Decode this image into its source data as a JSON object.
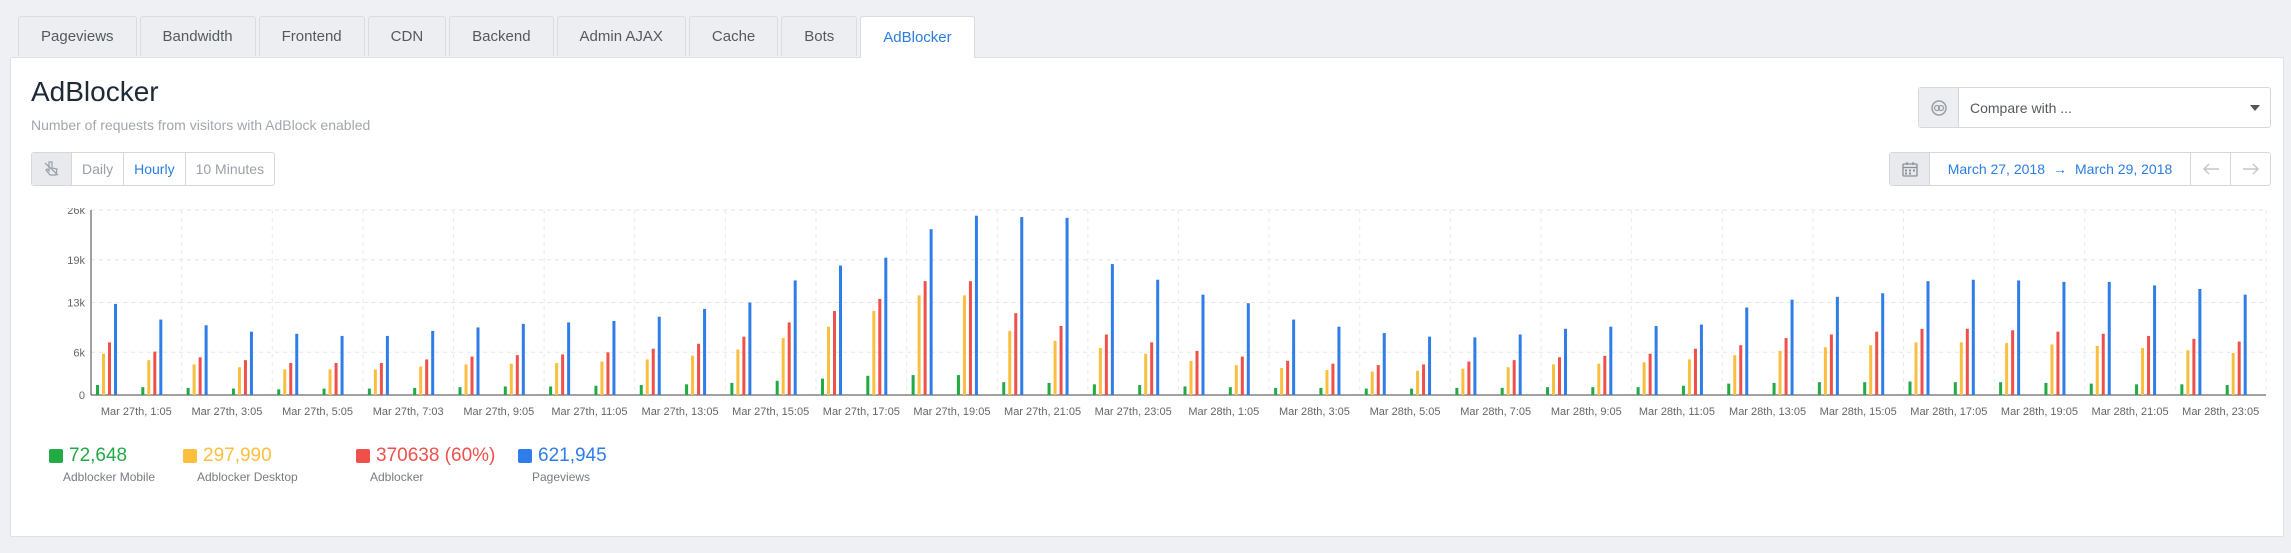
{
  "tabs": [
    {
      "label": "Pageviews",
      "active": false
    },
    {
      "label": "Bandwidth",
      "active": false
    },
    {
      "label": "Frontend",
      "active": false
    },
    {
      "label": "CDN",
      "active": false
    },
    {
      "label": "Backend",
      "active": false
    },
    {
      "label": "Admin AJAX",
      "active": false
    },
    {
      "label": "Cache",
      "active": false
    },
    {
      "label": "Bots",
      "active": false
    },
    {
      "label": "AdBlocker",
      "active": true
    }
  ],
  "header": {
    "title": "AdBlocker",
    "subtitle": "Number of requests from visitors with AdBlock enabled"
  },
  "compare": {
    "placeholder": "Compare with ..."
  },
  "granularity": {
    "options": [
      "Daily",
      "Hourly",
      "10 Minutes"
    ],
    "selected": "Hourly"
  },
  "date_range": {
    "start": "March 27, 2018",
    "end": "March 29, 2018",
    "arrow": "→"
  },
  "icons": {
    "compare": "link-circle-icon",
    "granularity": "pointer-hand-icon",
    "calendar": "calendar-icon",
    "prev": "arrow-left-icon",
    "next": "arrow-right-icon",
    "dropdown": "caret-down-icon"
  },
  "colors": {
    "mobile": "#22aa44",
    "desktop": "#fbbf3f",
    "adblocker": "#f0504a",
    "pageviews": "#2f7de8",
    "accent": "#2a7de1"
  },
  "legend": [
    {
      "value": "72,648",
      "label": "Adblocker Mobile",
      "color": "#22aa44"
    },
    {
      "value": "297,990",
      "label": "Adblocker Desktop",
      "color": "#fbbf3f"
    },
    {
      "value": "370638 (60%)",
      "label": "Adblocker",
      "color": "#f0504a"
    },
    {
      "value": "621,945",
      "label": "Pageviews",
      "color": "#2f7de8"
    }
  ],
  "chart_data": {
    "type": "bar",
    "yticks": [
      "0",
      "6k",
      "13k",
      "19k",
      "26k"
    ],
    "ytick_values": [
      0,
      6000,
      13000,
      19000,
      26000
    ],
    "ylim": [
      0,
      26000
    ],
    "xticks": [
      "Mar 27th, 1:05",
      "Mar 27th, 3:05",
      "Mar 27th, 5:05",
      "Mar 27th, 7:03",
      "Mar 27th, 9:05",
      "Mar 27th, 11:05",
      "Mar 27th, 13:05",
      "Mar 27th, 15:05",
      "Mar 27th, 17:05",
      "Mar 27th, 19:05",
      "Mar 27th, 21:05",
      "Mar 27th, 23:05",
      "Mar 28th, 1:05",
      "Mar 28th, 3:05",
      "Mar 28th, 5:05",
      "Mar 28th, 7:05",
      "Mar 28th, 9:05",
      "Mar 28th, 11:05",
      "Mar 28th, 13:05",
      "Mar 28th, 15:05",
      "Mar 28th, 17:05",
      "Mar 28th, 19:05",
      "Mar 28th, 21:05",
      "Mar 28th, 23:05"
    ],
    "series": [
      {
        "name": "Adblocker Mobile",
        "color": "#22aa44",
        "values": [
          1400,
          1100,
          1000,
          900,
          800,
          900,
          900,
          1000,
          1100,
          1200,
          1200,
          1300,
          1400,
          1500,
          1700,
          2000,
          2300,
          2700,
          2800,
          2800,
          1800,
          1700,
          1500,
          1400,
          1200,
          1100,
          1000,
          1000,
          900,
          900,
          1000,
          1000,
          1100,
          1100,
          1100,
          1300,
          1600,
          1700,
          1800,
          1800,
          1900,
          1800,
          1800,
          1700,
          1600,
          1500,
          1500,
          1400
        ]
      },
      {
        "name": "Adblocker Desktop",
        "color": "#fbbf3f",
        "values": [
          5800,
          4900,
          4300,
          3900,
          3600,
          3600,
          3600,
          4000,
          4300,
          4400,
          4500,
          4700,
          5000,
          5500,
          6400,
          8000,
          9600,
          11800,
          14000,
          14000,
          9000,
          7600,
          6600,
          5800,
          4800,
          4200,
          3800,
          3500,
          3300,
          3400,
          3700,
          3900,
          4300,
          4400,
          4600,
          5000,
          5600,
          6200,
          6700,
          7000,
          7400,
          7400,
          7300,
          7100,
          6900,
          6600,
          6300,
          5900
        ]
      },
      {
        "name": "Adblocker",
        "color": "#f0504a",
        "values": [
          7400,
          6100,
          5300,
          4900,
          4500,
          4500,
          4500,
          5000,
          5400,
          5600,
          5700,
          6000,
          6500,
          7200,
          8200,
          10200,
          11800,
          13500,
          16000,
          16000,
          11500,
          9700,
          8500,
          7400,
          6200,
          5400,
          4800,
          4400,
          4200,
          4300,
          4700,
          4900,
          5300,
          5500,
          5800,
          6500,
          7000,
          8000,
          8500,
          8900,
          9300,
          9300,
          9100,
          8900,
          8600,
          8300,
          7900,
          7500
        ]
      },
      {
        "name": "Pageviews",
        "color": "#2f7de8",
        "values": [
          12800,
          10600,
          9800,
          8900,
          8600,
          8300,
          8300,
          9000,
          9500,
          10000,
          10200,
          10400,
          11000,
          12100,
          13000,
          16100,
          18200,
          19300,
          23300,
          25200,
          25000,
          24900,
          18400,
          16200,
          14100,
          12900,
          10600,
          9600,
          8700,
          8200,
          8100,
          8500,
          9300,
          9600,
          9700,
          9900,
          12300,
          13400,
          13800,
          14300,
          16000,
          16200,
          16100,
          15900,
          15900,
          15400,
          14900,
          14100
        ]
      }
    ]
  }
}
